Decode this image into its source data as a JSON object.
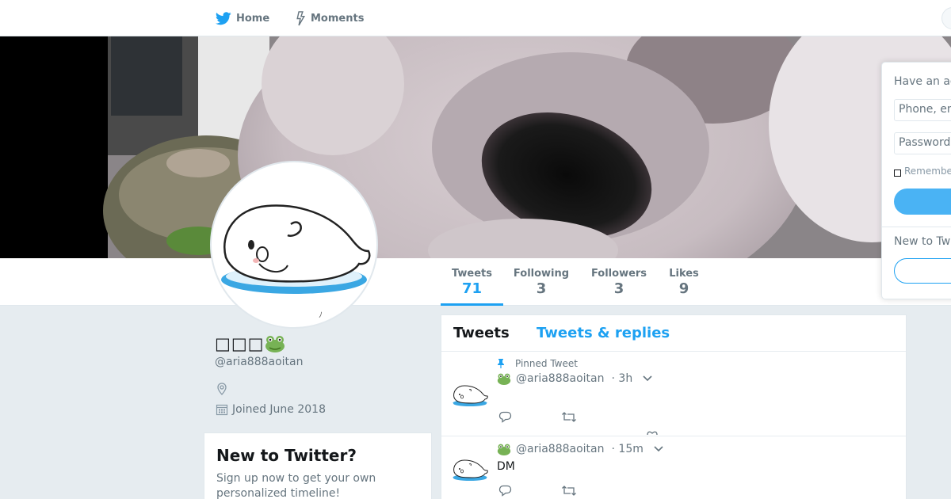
{
  "nav": {
    "home_label": "Home",
    "moments_label": "Moments",
    "icons": [
      "twitter-bird-icon",
      "lightning-icon"
    ]
  },
  "profile": {
    "name_text": "□□□",
    "name_emoji": "frog-icon",
    "handle": "@aria888aoitan",
    "joined": "Joined June 2018"
  },
  "stats": {
    "tweets": {
      "label": "Tweets",
      "value": "71"
    },
    "following": {
      "label": "Following",
      "value": "3"
    },
    "followers": {
      "label": "Followers",
      "value": "3"
    },
    "likes": {
      "label": "Likes",
      "value": "9"
    }
  },
  "login": {
    "have_account": "Have an ac",
    "phone_placeholder": "Phone, em",
    "password_placeholder": "Password",
    "remember": "Remembe",
    "new_to": "New to Twi"
  },
  "new_module": {
    "title": "New to Twitter?",
    "body": "Sign up now to get your own personalized timeline!"
  },
  "timeline": {
    "tabs": [
      {
        "label": "Tweets",
        "active": true
      },
      {
        "label": "Tweets & replies",
        "active": false
      }
    ],
    "tweets": [
      {
        "pinned_label": "Pinned Tweet",
        "handle": "@aria888aoitan",
        "time": "· 3h",
        "text": ""
      },
      {
        "pinned_label": "",
        "handle": "@aria888aoitan",
        "time": "· 15m",
        "text": "DM"
      }
    ]
  },
  "colors": {
    "accent": "#1da1f2",
    "background": "#e6ecf0",
    "muted": "#66757f"
  }
}
